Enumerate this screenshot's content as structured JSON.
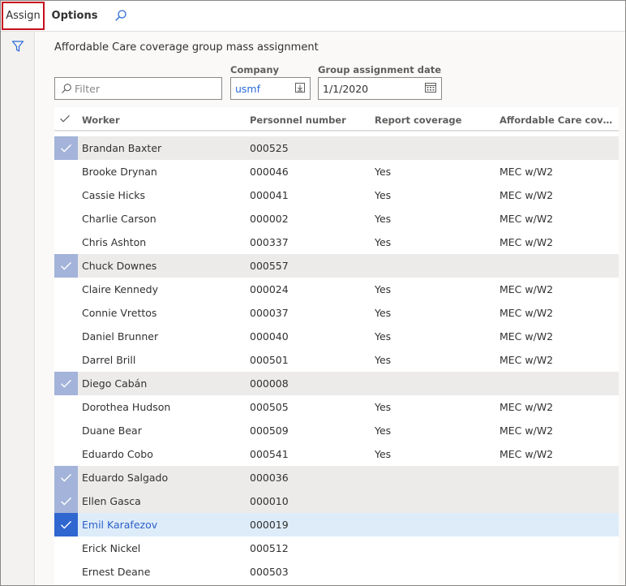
{
  "action_pane": {
    "assign_label": "Assign",
    "options_label": "Options"
  },
  "page": {
    "title": "Affordable Care coverage group mass assignment"
  },
  "fields": {
    "filter_placeholder": "Filter",
    "company_label": "Company",
    "company_value": "usmf",
    "date_label": "Group assignment date",
    "date_value": "1/1/2020"
  },
  "grid": {
    "columns": [
      "Worker",
      "Personnel number",
      "Report coverage",
      "Affordable Care coverage ..."
    ],
    "rows": [
      {
        "worker": "Brandan Baxter",
        "pn": "000525",
        "rc": "",
        "ac": "",
        "state": "selected"
      },
      {
        "worker": "Brooke Drynan",
        "pn": "000046",
        "rc": "Yes",
        "ac": "MEC w/W2",
        "state": "none"
      },
      {
        "worker": "Cassie Hicks",
        "pn": "000041",
        "rc": "Yes",
        "ac": "MEC w/W2",
        "state": "none"
      },
      {
        "worker": "Charlie Carson",
        "pn": "000002",
        "rc": "Yes",
        "ac": "MEC w/W2",
        "state": "none"
      },
      {
        "worker": "Chris Ashton",
        "pn": "000337",
        "rc": "Yes",
        "ac": "MEC w/W2",
        "state": "none"
      },
      {
        "worker": "Chuck Downes",
        "pn": "000557",
        "rc": "",
        "ac": "",
        "state": "selected"
      },
      {
        "worker": "Claire Kennedy",
        "pn": "000024",
        "rc": "Yes",
        "ac": "MEC w/W2",
        "state": "none"
      },
      {
        "worker": "Connie Vrettos",
        "pn": "000037",
        "rc": "Yes",
        "ac": "MEC w/W2",
        "state": "none"
      },
      {
        "worker": "Daniel Brunner",
        "pn": "000040",
        "rc": "Yes",
        "ac": "MEC w/W2",
        "state": "none"
      },
      {
        "worker": "Darrel Brill",
        "pn": "000501",
        "rc": "Yes",
        "ac": "MEC w/W2",
        "state": "none"
      },
      {
        "worker": "Diego Cabán",
        "pn": "000008",
        "rc": "",
        "ac": "",
        "state": "selected"
      },
      {
        "worker": "Dorothea Hudson",
        "pn": "000505",
        "rc": "Yes",
        "ac": "MEC w/W2",
        "state": "none"
      },
      {
        "worker": "Duane Bear",
        "pn": "000509",
        "rc": "Yes",
        "ac": "MEC w/W2",
        "state": "none"
      },
      {
        "worker": "Eduardo Cobo",
        "pn": "000541",
        "rc": "Yes",
        "ac": "MEC w/W2",
        "state": "none"
      },
      {
        "worker": "Eduardo Salgado",
        "pn": "000036",
        "rc": "",
        "ac": "",
        "state": "selected"
      },
      {
        "worker": "Ellen Gasca",
        "pn": "000010",
        "rc": "",
        "ac": "",
        "state": "selected"
      },
      {
        "worker": "Emil Karafezov",
        "pn": "000019",
        "rc": "",
        "ac": "",
        "state": "active"
      },
      {
        "worker": "Erick Nickel",
        "pn": "000512",
        "rc": "",
        "ac": "",
        "state": "none"
      },
      {
        "worker": "Ernest Deane",
        "pn": "000503",
        "rc": "",
        "ac": "",
        "state": "none"
      }
    ]
  },
  "icons": {
    "search": "search-icon",
    "filter_pane": "funnel-icon",
    "lookup": "lookup-icon",
    "calendar": "calendar-icon",
    "check": "checkmark-icon"
  },
  "colors": {
    "assign_highlight": "#c50f1f",
    "selected_check": "#a3b3d9",
    "active_check": "#2f66d0",
    "active_row": "#deecf9",
    "link_text": "#2b6bd6"
  }
}
